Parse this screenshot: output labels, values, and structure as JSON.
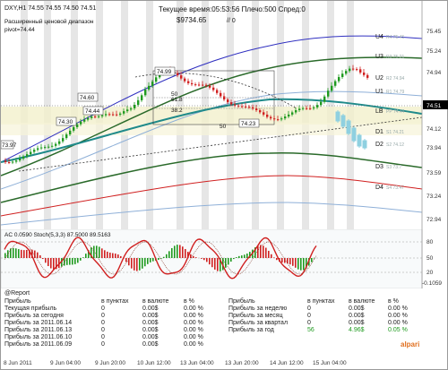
{
  "chart_header": {
    "symbol_line": "DXY,H1  74.55 74.55 74.50 74.51",
    "range_label": "Расширенный ценовой диапазон",
    "pivot_label": "pivot=74.44",
    "time_label": "Текущее время:05:53:56 Плечо:500 Спред:0",
    "balance": "$9734.65",
    "lot": "// 0"
  },
  "price_axis": {
    "ticks": [
      "75.45",
      "75.24",
      "74.94",
      "74.51",
      "74.12",
      "73.94",
      "73.59",
      "73.24",
      "72.94"
    ],
    "current_price": "74.51"
  },
  "level_labels": [
    "U4",
    "U3",
    "U2",
    "U1",
    "LB",
    "D1",
    "D2",
    "D3",
    "D4"
  ],
  "level_values": [
    "R4 75.45",
    "R3 75.21",
    "R2 74.94",
    "R1 74.79",
    "PP 74.44",
    "S1 74.21",
    "S2 74.12",
    "S3 73.7",
    "S4 73.47"
  ],
  "price_marks": [
    "74.99",
    "74.60",
    "74.30",
    "74.44",
    "61.8",
    "50",
    "38.2",
    "74.23",
    "50",
    "73.97"
  ],
  "indicator": {
    "label": "AC 0.0590  Stoch(5,3,3) 87.5000 89.5163",
    "right_values": [
      "80",
      "50",
      "20",
      "-0.1059"
    ]
  },
  "report": {
    "title": "@Report",
    "left_headers": [
      "Прибыль",
      "в пунктах",
      "в валюте",
      "в %"
    ],
    "left_rows": [
      [
        "Текущая прибыль",
        "0",
        "0.00$",
        "0.00 %"
      ],
      [
        "Прибыль за сегодня",
        "0",
        "0.00$",
        "0.00 %"
      ],
      [
        "Прибыль за 2011.06.14",
        "0",
        "0.00$",
        "0.00 %"
      ],
      [
        "Прибыль за 2011.06.13",
        "0",
        "0.00$",
        "0.00 %"
      ],
      [
        "Прибыль за 2011.06.10",
        "0",
        "0.00$",
        "0.00 %"
      ],
      [
        "Прибыль за 2011.06.09",
        "0",
        "0.00$",
        "0.00 %"
      ]
    ],
    "right_headers": [
      "Прибыль",
      "в пунктах",
      "в валюте",
      "в %"
    ],
    "right_rows": [
      [
        "Прибыль за неделю",
        "0",
        "0.00$",
        "0.00 %"
      ],
      [
        "Прибыль за месяц",
        "0",
        "0.00$",
        "0.00 %"
      ],
      [
        "Прибыль за квартал",
        "0",
        "0.00$",
        "0.00 %"
      ],
      [
        "Прибыль за год",
        "56",
        "4.96$",
        "0.05 %"
      ]
    ],
    "logo_text": "alpari"
  },
  "time_axis": [
    "8 Jun 2011",
    "9 Jun 04:00",
    "9 Jun 20:00",
    "10 Jun 12:00",
    "13 Jun 04:00",
    "13 Jun 20:00",
    "14 Jun 12:00",
    "15 Jun 04:00"
  ],
  "colors": {
    "bull": "#1f9a1f",
    "bear": "#d02020",
    "level_line": "#2a5a9a",
    "pivot": "#1f8a8a",
    "projection": "#8fd0e0"
  }
}
